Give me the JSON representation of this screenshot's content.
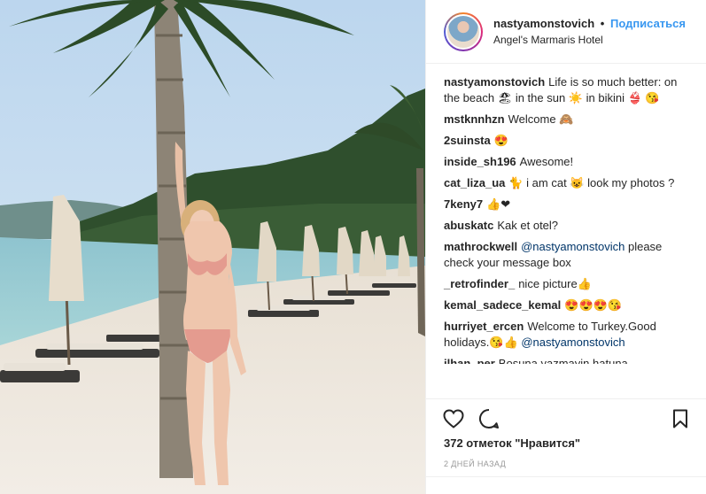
{
  "post": {
    "username": "nastyamonstovich",
    "separator": "•",
    "follow_label": "Подписаться",
    "location": "Angel's Marmaris Hotel"
  },
  "comments": [
    {
      "user": "nastyamonstovich",
      "text": "Life is so much better: on the beach 🏖 in the sun ☀️ in bikini 👙 😘"
    },
    {
      "user": "mstknnhzn",
      "text": "Welcome 🙈"
    },
    {
      "user": "2suinsta",
      "text": "😍"
    },
    {
      "user": "inside_sh196",
      "text": "Awesome!"
    },
    {
      "user": "cat_liza_ua",
      "text": "🐈 i am cat 😺 look my photos ?"
    },
    {
      "user": "7keny7",
      "text": "👍❤"
    },
    {
      "user": "abuskatc",
      "text": "Kak et otel?"
    },
    {
      "user": "mathrockwell",
      "mention": "@nastyamonstovich",
      "text": "please check your message box"
    },
    {
      "user": "_retrofinder_",
      "text": "nice picture👍"
    },
    {
      "user": "kemal_sadece_kemal",
      "text": "😍😍😍😘"
    },
    {
      "user": "hurriyet_ercen",
      "text": "Welcome to Turkey.Good holidays.😘👍",
      "mention": "@nastyamonstovich"
    },
    {
      "user": "ilhan_per",
      "text": "Bosuna yazmayin hatuna"
    }
  ],
  "actions": {
    "like_icon": "heart-icon",
    "comment_icon": "comment-bubble-icon",
    "save_icon": "bookmark-icon"
  },
  "likes_text": "372 отметок \"Нравится\"",
  "time_text": "2 ДНЕЙ НАЗАД"
}
